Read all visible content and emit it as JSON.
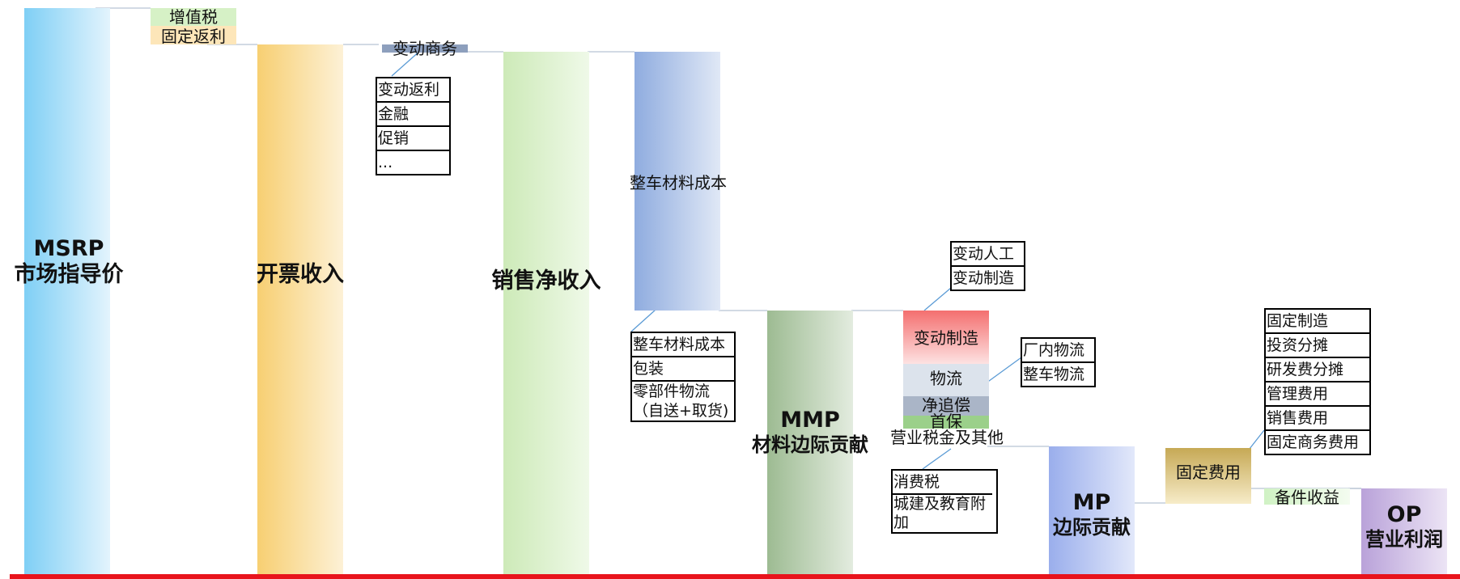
{
  "bars": {
    "msrp": {
      "line1": "MSRP",
      "line2": "市场指导价"
    },
    "invoice": {
      "label": "开票收入"
    },
    "net_sales": {
      "label": "销售净收入"
    },
    "vehicle_material": {
      "label": "整车材料成本"
    },
    "mmp": {
      "line1": "MMP",
      "line2": "材料边际贡献"
    },
    "mp": {
      "line1": "MP",
      "line2": "边际贡献"
    },
    "op": {
      "line1": "OP",
      "line2": "营业利润"
    }
  },
  "deductions": {
    "vat": "增值税",
    "fixed_rebate": "固定返利",
    "variable_business": "变动商务",
    "variable_manufacturing": "变动制造",
    "logistics": "物流",
    "net_compensation": "净追偿",
    "warranty": "首保",
    "business_tax": "营业税金及其他",
    "fixed_cost": "固定费用",
    "spare_parts_income": "备件收益"
  },
  "detail_boxes": {
    "variable_business_items": [
      "变动返利",
      "金融",
      "促销",
      "..."
    ],
    "material_items": [
      "整车材料成本",
      "包装",
      "零部件物流",
      "（自送+取货)"
    ],
    "labor_items": [
      "变动人工",
      "变动制造"
    ],
    "logistics_items": [
      "厂内物流",
      "整车物流"
    ],
    "tax_items": [
      "消费税",
      "城建及教育附加"
    ],
    "fixed_items": [
      "固定制造",
      "投资分摊",
      "研发费分摊",
      "管理费用",
      "销售费用",
      "固定商务费用"
    ]
  },
  "colors": {
    "baseline": "#e8141c",
    "msrp": "#7fcff5",
    "invoice": "#f7cf72",
    "net_sales": "#cdeab8",
    "vehicle_material": "#8facdf",
    "mmp": "#9dbb92",
    "mp": "#9aaeec",
    "op": "#b9a2d9",
    "variable_manufacturing": "#f46f6f",
    "fixed_cost": "#c6a955"
  }
}
